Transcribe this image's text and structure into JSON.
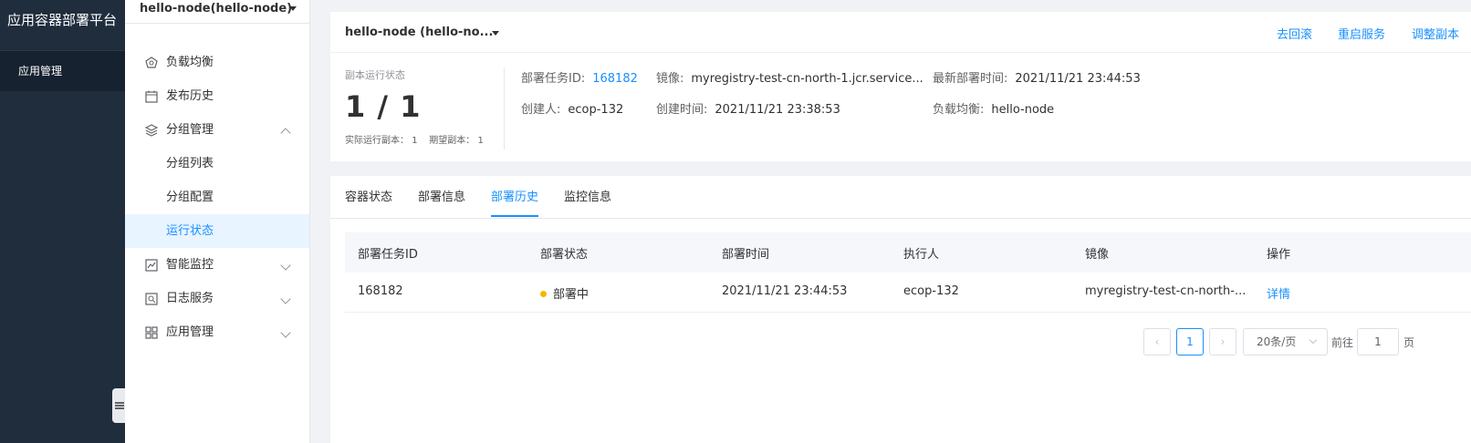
{
  "nav": {
    "brand": "应用容器部署平台",
    "items": [
      {
        "label": "应用管理"
      }
    ]
  },
  "sidebar": {
    "app_selector": "hello-node(hello-node)",
    "items": [
      {
        "label": "负载均衡",
        "icon": "load-balance-icon"
      },
      {
        "label": "发布历史",
        "icon": "calendar-icon"
      },
      {
        "label": "分组管理",
        "icon": "layers-icon",
        "expanded": true
      },
      {
        "label": "分组列表"
      },
      {
        "label": "分组配置"
      },
      {
        "label": "运行状态",
        "active": true
      },
      {
        "label": "智能监控",
        "icon": "chart-icon"
      },
      {
        "label": "日志服务",
        "icon": "log-search-icon"
      },
      {
        "label": "应用管理",
        "icon": "grid-icon"
      }
    ]
  },
  "header": {
    "title": "hello-node (hello-no...",
    "actions": {
      "rollback": "去回滚",
      "restart": "重启服务",
      "scale": "调整副本"
    }
  },
  "replica": {
    "label": "副本运行状态",
    "value": "1 / 1",
    "actual_label": "实际运行副本：",
    "actual_value": "1",
    "desired_label": "期望副本：",
    "desired_value": "1"
  },
  "info": {
    "task_id_label": "部署任务ID:",
    "task_id": "168182",
    "image_label": "镜像:",
    "image": "myregistry-test-cn-north-1.jcr.service...",
    "latest_time_label": "最新部署时间:",
    "latest_time": "2021/11/21 23:44:53",
    "creator_label": "创建人:",
    "creator": "ecop-132",
    "created_label": "创建时间:",
    "created": "2021/11/21 23:38:53",
    "lb_label": "负载均衡:",
    "lb": "hello-node"
  },
  "tabs": [
    "容器状态",
    "部署信息",
    "部署历史",
    "监控信息"
  ],
  "active_tab": 2,
  "table": {
    "columns": [
      "部署任务ID",
      "部署状态",
      "部署时间",
      "执行人",
      "镜像",
      "操作"
    ],
    "rows": [
      {
        "id": "168182",
        "status": "部署中",
        "status_color": "#f5b800",
        "time": "2021/11/21 23:44:53",
        "operator": "ecop-132",
        "image": "myregistry-test-cn-north-...",
        "action": "详情"
      }
    ]
  },
  "pagination": {
    "current": "1",
    "page_size": "20条/页",
    "goto_prefix": "前往",
    "goto_value": "1",
    "goto_suffix": "页"
  },
  "colors": {
    "primary": "#1890ff",
    "nav_bg": "#1f2d3d",
    "status_deploying": "#f5b800"
  }
}
